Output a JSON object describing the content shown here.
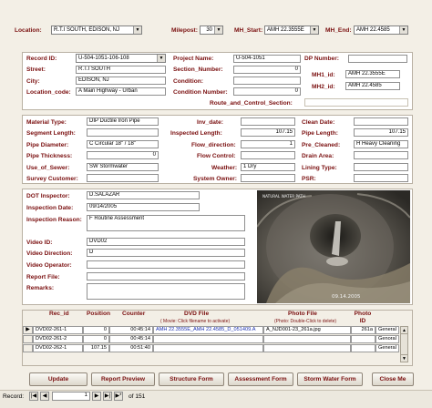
{
  "header": {
    "location_label": "Location:",
    "location_value": "R.T.I SOUTH, EDISON, NJ",
    "milepost_label": "Milepost:",
    "milepost_value": "30",
    "mh_start_label": "MH_Start:",
    "mh_start_value": "AMH 22.3555E",
    "mh_end_label": "MH_End:",
    "mh_end_value": "AMH 22.4585"
  },
  "record": {
    "record_id_label": "Record ID:",
    "record_id_value": "U-504-1051-106-108",
    "street_label": "Street:",
    "street_value": "R.T.I SOUTH",
    "city_label": "City:",
    "city_value": "EDISON, NJ",
    "location_code_label": "Location_code:",
    "location_code_value": "A Main Highway - Urban",
    "project_name_label": "Project Name:",
    "project_name_value": "U-504-1051",
    "section_number_label": "Section_Number:",
    "section_number_value": "0",
    "condition_label": "Condition:",
    "condition_value": "",
    "condition_number_label": "Condition Number:",
    "condition_number_value": "0",
    "route_section_label": "Route_and_Control_Section:",
    "dp_number_label": "DP Number:",
    "dp_number_value": "",
    "mh1_label": "MH1_id:",
    "mh1_value": "AMH 22.3555E",
    "mh2_label": "MH2_id:",
    "mh2_value": "AMH 22.4585"
  },
  "pipe": {
    "material_type_label": "Material Type:",
    "material_type_value": "DIP Ductile Iron Pipe",
    "segment_length_label": "Segment Length:",
    "segment_length_value": "",
    "pipe_diameter_label": "Pipe Diameter:",
    "pipe_diameter_value": "C Circular 18\" / 18\"",
    "pipe_thickness_label": "Pipe Thickness:",
    "pipe_thickness_value": "0",
    "use_of_sewer_label": "Use_of_Sewer:",
    "use_of_sewer_value": "SW Stormwater",
    "survey_customer_label": "Survey Customer:",
    "survey_customer_value": "",
    "inv_date_label": "Inv_date:",
    "inv_date_value": "",
    "inspected_length_label": "Inspected Length:",
    "inspected_length_value": "107.15",
    "flow_direction_label": "Flow_direction:",
    "flow_direction_value": "1",
    "flow_control_label": "Flow Control:",
    "flow_control_value": "",
    "weather_label": "Weather:",
    "weather_value": "1 Dry",
    "system_owner_label": "System Owner:",
    "system_owner_value": "",
    "clean_date_label": "Clean Date:",
    "clean_date_value": "",
    "pipe_length_label": "Pipe Length:",
    "pipe_length_value": "107.15",
    "pre_cleaned_label": "Pre_Cleaned:",
    "pre_cleaned_value": "H Heavy Cleaning",
    "drain_area_label": "Drain Area:",
    "drain_area_value": "",
    "lining_type_label": "Lining Type:",
    "lining_type_value": "",
    "psr_label": "PSR:",
    "psr_value": ""
  },
  "inspection": {
    "dot_inspector_label": "DOT Inspector:",
    "dot_inspector_value": "D.SALAZAR",
    "inspection_date_label": "Inspection Date:",
    "inspection_date_value": "09/14/2005",
    "inspection_reason_label": "Inspection Reason:",
    "inspection_reason_value": "F Routine Assessment",
    "video_id_label": "Video ID:",
    "video_id_value": "DVD02",
    "video_direction_label": "Video Direction:",
    "video_direction_value": "D",
    "video_operator_label": "Video Operator:",
    "video_operator_value": "",
    "report_file_label": "Report File:",
    "report_file_value": "",
    "remarks_label": "Remarks:",
    "remarks_value": "",
    "photo_overlay_top": "NATURAL WATER PATH",
    "photo_overlay_date": "09.14.2005"
  },
  "grid": {
    "headers": {
      "rec_id": "Rec_id",
      "position": "Position",
      "counter": "Counter",
      "dvd_file": "DVD File",
      "dvd_file_sub": "( Movie: Click filename to activate)",
      "photo_file": "Photo File",
      "photo_file_sub": "(Photo: Double-Click to delete)",
      "photo_id": "Photo ID",
      "last": ""
    },
    "rows": [
      {
        "rec_id": "DVD02-261-1",
        "position": "0",
        "counter": "00:45:14",
        "dvd_file": "AMH 22.3555E_AMH 22.4585_D_051409.A",
        "photo_file": "A_NJD001-23_261a.jpg",
        "photo_id": "261a",
        "last": "General"
      },
      {
        "rec_id": "DVD02-261-2",
        "position": "0",
        "counter": "00:45:14",
        "dvd_file": "",
        "photo_file": "",
        "photo_id": "",
        "last": "Genoral"
      },
      {
        "rec_id": "DVD02-262-1",
        "position": "107.15",
        "counter": "00:51:40",
        "dvd_file": "",
        "photo_file": "",
        "photo_id": "",
        "last": "General"
      }
    ]
  },
  "buttons": {
    "update": "Update",
    "report_preview": "Report Preview",
    "structure_form": "Structure Form",
    "assessment_form": "Assessment Form",
    "storm_water_form": "Storm Water Form",
    "close_me": "Close Me"
  },
  "nav": {
    "record_label": "Record:",
    "current": "1",
    "of_label": "of 151"
  }
}
